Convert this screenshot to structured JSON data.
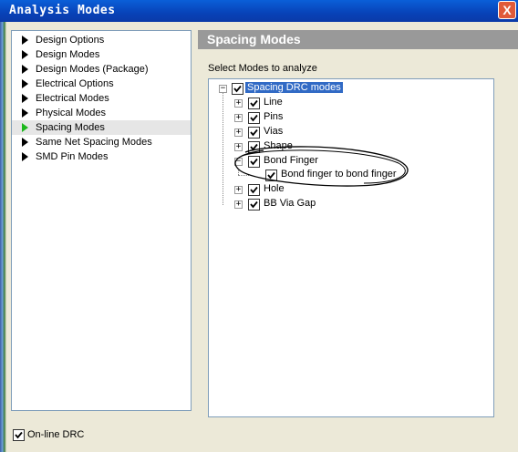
{
  "window": {
    "title": "Analysis Modes",
    "close_label": "X"
  },
  "nav": {
    "items": [
      {
        "label": "Design Options",
        "selected": false
      },
      {
        "label": "Design Modes",
        "selected": false
      },
      {
        "label": "Design Modes (Package)",
        "selected": false
      },
      {
        "label": "Electrical Options",
        "selected": false
      },
      {
        "label": "Electrical Modes",
        "selected": false
      },
      {
        "label": "Physical Modes",
        "selected": false
      },
      {
        "label": "Spacing Modes",
        "selected": true
      },
      {
        "label": "Same Net Spacing Modes",
        "selected": false
      },
      {
        "label": "SMD Pin Modes",
        "selected": false
      }
    ]
  },
  "panel": {
    "title": "Spacing Modes",
    "subtitle": "Select Modes to analyze",
    "tree": {
      "root": {
        "label": "Spacing DRC modes",
        "checked": true,
        "expanded": true
      },
      "children": [
        {
          "label": "Line",
          "checked": true,
          "expanded": false
        },
        {
          "label": "Pins",
          "checked": true,
          "expanded": false
        },
        {
          "label": "Vias",
          "checked": true,
          "expanded": false
        },
        {
          "label": "Shape",
          "checked": true,
          "expanded": false
        },
        {
          "label": "Bond Finger",
          "checked": true,
          "expanded": true,
          "children": [
            {
              "label": "Bond finger to bond finger",
              "checked": true
            }
          ]
        },
        {
          "label": "Hole",
          "checked": true,
          "expanded": false
        },
        {
          "label": "BB Via Gap",
          "checked": true,
          "expanded": false
        }
      ]
    }
  },
  "footer": {
    "online_drc_label": "On-line DRC",
    "online_drc_checked": true
  },
  "colors": {
    "title_bar": "#0a4fc8",
    "selection": "#316ac5",
    "header_bg": "#999999",
    "active_arrow": "#1db81d"
  }
}
